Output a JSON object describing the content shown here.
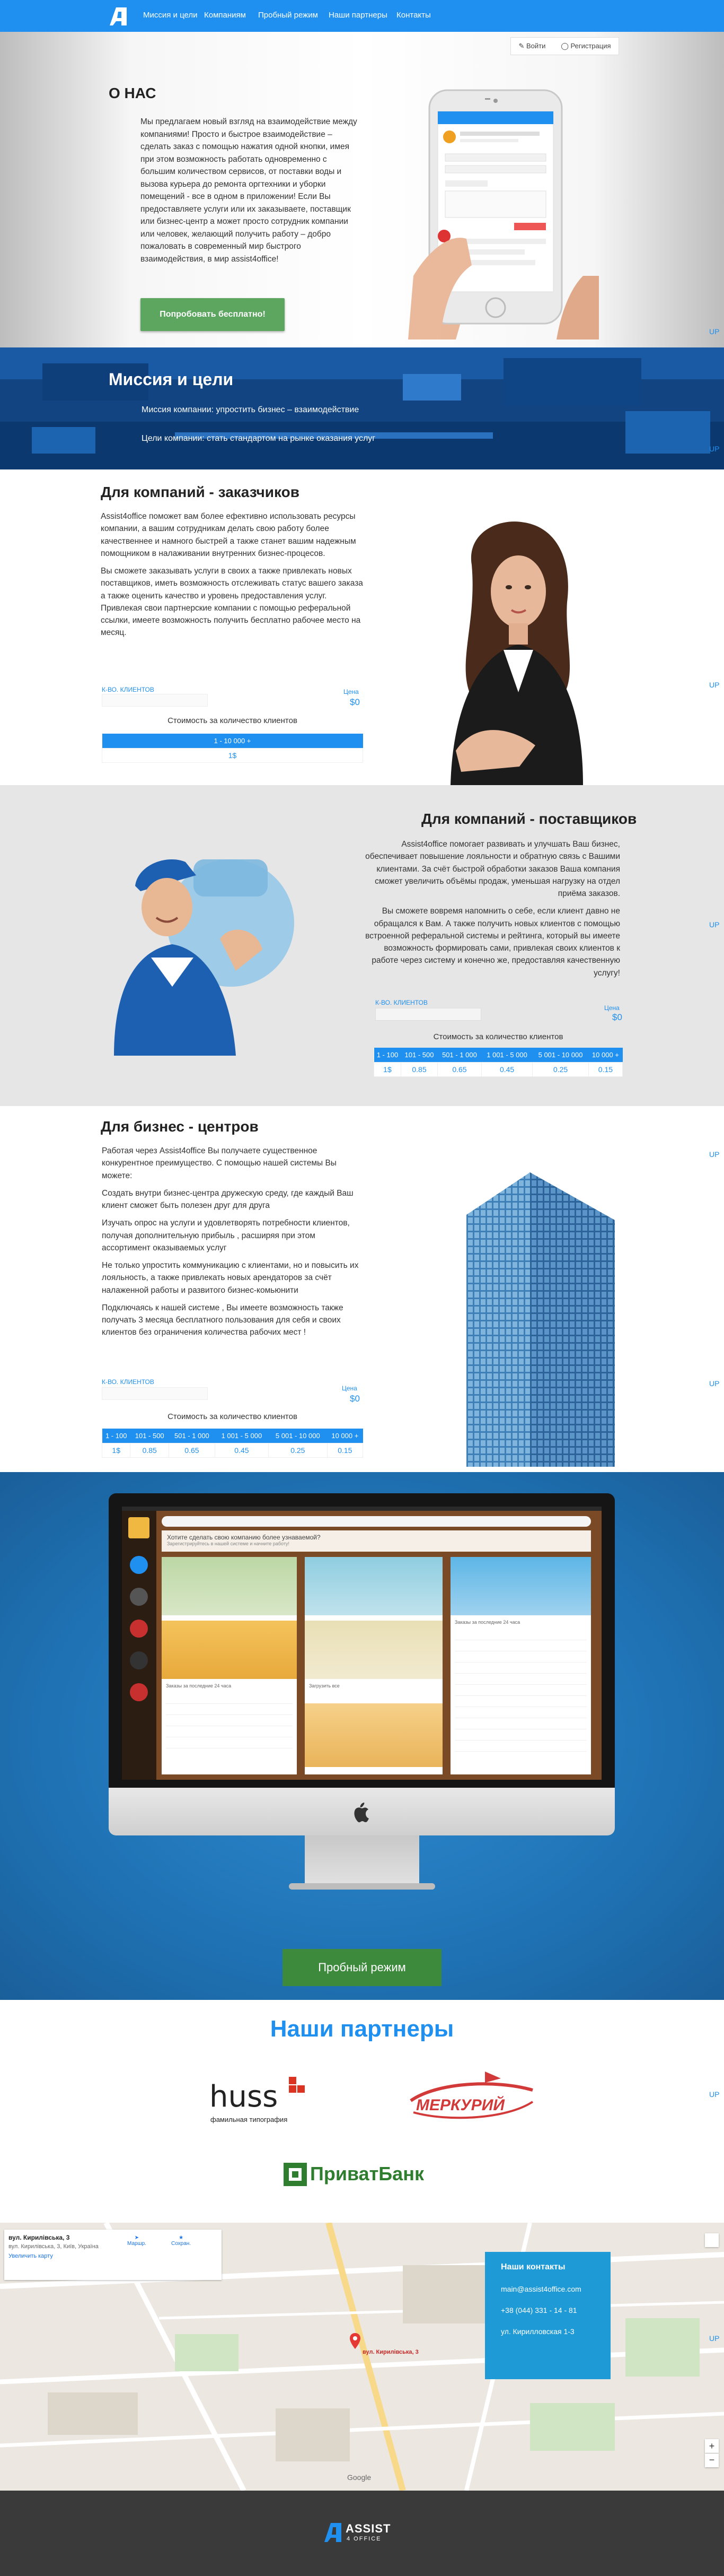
{
  "nav": {
    "items": [
      "Миссия и цели",
      "Компаниям",
      "Пробный режим",
      "Наши партнеры",
      "Контакты"
    ],
    "login": "Войти",
    "register": "Регистрация"
  },
  "about": {
    "title": "О НАС",
    "text": "Мы предлагаем новый взгляд на взаимодействие между компаниями! Просто и быстрое взаимодействие – сделать заказ с помощью нажатия одной кнопки, имея при этом возможность работать одновременно с большим количеством сервисов, от поставки воды и вызова курьера до ремонта оргтехники и уборки помещений - все в одном в приложении! Если Вы предоставляете услуги или их заказываете, поставщик или бизнес-центр а может просто сотрудник компании или человек, желающий получить работу – добро пожаловать в современный мир быстрого взаимодействия, в мир assist4office!",
    "try_button": "Попробовать бесплатно!"
  },
  "mission": {
    "title": "Миссия и цели",
    "line1": "Миссия компании: упростить бизнес – взаимодействие",
    "line2": "Цели компании: стать стандартом на рынке оказания услуг"
  },
  "up_label": "UP",
  "clients": {
    "title": "Для компаний - заказчиков",
    "p1": "Assist4office поможет вам более ефективно использовать ресурсы компании, а вашим сотрудникам делать свою работу более качественнее и намного быстрей а также станет вашим надежным помощником в налаживании внутренних бизнес-процесов.",
    "p2": "Вы сможете заказывать услуги в своих а также привлекать новых поставщиков, иметь возможность отслеживать статус вашего заказа а также оценить качество и уровень предоставления услуг. Привлекая свои партнерские компании с помощью реферальной ссылки, имеете возможность получить бесплатно рабочее место на месяц.",
    "label_left": "К-ВО. КЛИЕНТОВ",
    "label_right": "Цена",
    "price": "$0",
    "count_title": "Стоимость за количество клиентов",
    "table_head": [
      "1 - 10 000 +"
    ],
    "table_row": [
      "1$"
    ]
  },
  "providers": {
    "title": "Для компаний - поставщиков",
    "p1": "Assist4office помогает развивать и улучшать Ваш бизнес, обеспечивает повышение лояльности и обратную связь с Вашими клиентами. За счёт быстрой обработки заказов Ваша компания сможет увеличить объёмы продаж, уменьшая нагрузку на отдел приёма заказов.",
    "p2": "Вы сможете вовремя напомнить о себе, если клиент давно не обращался к Вам. А также получить новых клиентов с помощью встроенной реферальной системы и рейтинга, который вы имеете возможность формировать сами, привлекая своих клиентов к работе через систему и конечно же, предоставляя качественную услугу!",
    "label_left": "К-ВО. КЛИЕНТОВ",
    "label_right": "Цена",
    "price": "$0",
    "count_title": "Стоимость за количество клиентов",
    "table_head": [
      "1 - 100",
      "101 - 500",
      "501 - 1 000",
      "1 001 - 5 000",
      "5 001 - 10 000",
      "10 000 +"
    ],
    "table_row": [
      "1$",
      "0.85",
      "0.65",
      "0.45",
      "0.25",
      "0.15"
    ]
  },
  "bc": {
    "title": "Для бизнес - центров",
    "paras": [
      "Работая через Assist4office Вы получаете существенное конкурентное преимущество. С помощью нашей системы Вы можете:",
      "Создать внутри бизнес-центра дружескую среду, где каждый Ваш клиент сможет быть полезен друг для друга",
      "Изучать опрос на услуги и удовлетворять потребности клиентов, получая дополнительную прибыль , расширяя при этом ассортимент оказываемых услуг",
      "Не только упростить коммуникацию с клиентами, но и повысить их лояльность, а также привлекать новых арендаторов за счёт налаженной работы и развитого бизнес-комьюнити",
      "Подключаясь к нашей системе , Вы имеете возможность также получать 3 месяца бесплатного пользования для себя и своих клиентов без ограничения количества рабочих мест !"
    ],
    "label_left": "К-ВО. КЛИЕНТОВ",
    "label_right": "Цена",
    "price": "$0",
    "count_title": "Стоимость за количество клиентов",
    "table_head": [
      "1 - 100",
      "101 - 500",
      "501 - 1 000",
      "1 001 - 5 000",
      "5 001 - 10 000",
      "10 000 +"
    ],
    "table_row": [
      "1$",
      "0.85",
      "0.65",
      "0.45",
      "0.25",
      "0.15"
    ]
  },
  "app": {
    "banner": "Хотите сделать свою компанию более узнаваемой?",
    "banner_sub": "Зарегистрируйтесь в нашей системе и начните работу!",
    "orders_header": "Заказы за последние 24 часа",
    "more": "Загрузить все"
  },
  "demo_button": "Пробный режим",
  "partners": {
    "title": "Наши партнеры",
    "huss": "huss",
    "huss_sub": "фамильная типография",
    "mercury": "МЕРКУРИЙ",
    "privat": "ПриватБанк"
  },
  "map": {
    "card_title": "вул. Кирилівська, 3",
    "card_addr": "вул. Кирилівська, 3, Київ, Україна",
    "card_link": "Увеличить карту",
    "route": "Маршр.",
    "save": "Сохран.",
    "pin_label": "вул. Кирилівська, 3",
    "google": "Google"
  },
  "contacts": {
    "title": "Наши контакты",
    "email": "main@assist4office.com",
    "phone": "+38 (044) 331 - 14 - 81",
    "address": "ул. Кирилловская 1-3"
  },
  "footer": {
    "logo_assist": "ASSIST",
    "logo_office": "4 OFFICE"
  }
}
